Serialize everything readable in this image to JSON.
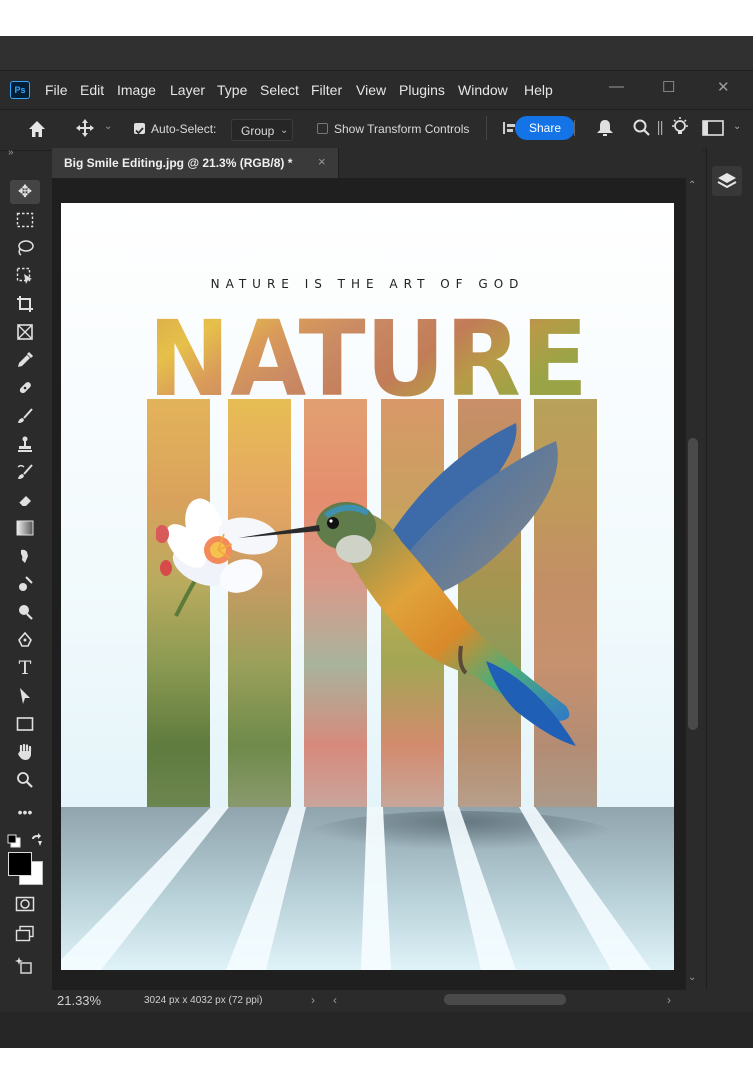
{
  "app": {
    "logo": "Ps"
  },
  "menu": {
    "items": [
      "File",
      "Edit",
      "Image",
      "Layer",
      "Type",
      "Select",
      "Filter",
      "View",
      "Plugins",
      "Window",
      "Help"
    ]
  },
  "window_controls": {
    "minimize": "—",
    "maximize": "☐",
    "close": "✕"
  },
  "options_bar": {
    "home_icon": "home-icon",
    "move_icon": "move-icon",
    "auto_select_label": "Auto-Select:",
    "auto_select_checked": true,
    "auto_select_target": "Group",
    "show_transform_label": "Show Transform Controls",
    "show_transform_checked": false,
    "share_label": "Share",
    "accent_color": "#1473e6"
  },
  "document_tab": {
    "title": "Big Smile Editing.jpg @ 21.3% (RGB/8) *",
    "close": "×"
  },
  "toolbar": {
    "tools": [
      "move-tool",
      "marquee-tool",
      "lasso-tool",
      "object-selection-tool",
      "crop-tool",
      "frame-tool",
      "eyedropper-tool",
      "spot-healing-tool",
      "brush-tool",
      "clone-stamp-tool",
      "history-brush-tool",
      "eraser-tool",
      "gradient-tool",
      "smudge-tool",
      "burn-tool",
      "dodge-tool",
      "pen-tool",
      "type-tool",
      "path-selection-tool",
      "rectangle-tool",
      "hand-tool",
      "zoom-tool",
      "more-tools",
      "default-colors",
      "color-swatches",
      "quick-mask",
      "screen-mode",
      "generative-expand"
    ],
    "foreground_color": "#000000",
    "background_color": "#ffffff"
  },
  "artwork": {
    "subtitle": "NATURE IS THE ART OF GOD",
    "headline": "NATURE"
  },
  "status": {
    "zoom": "21.33%",
    "doc_info": "3024 px x 4032 px (72 ppi)"
  },
  "panels": {
    "layers_icon": "layers-icon"
  }
}
